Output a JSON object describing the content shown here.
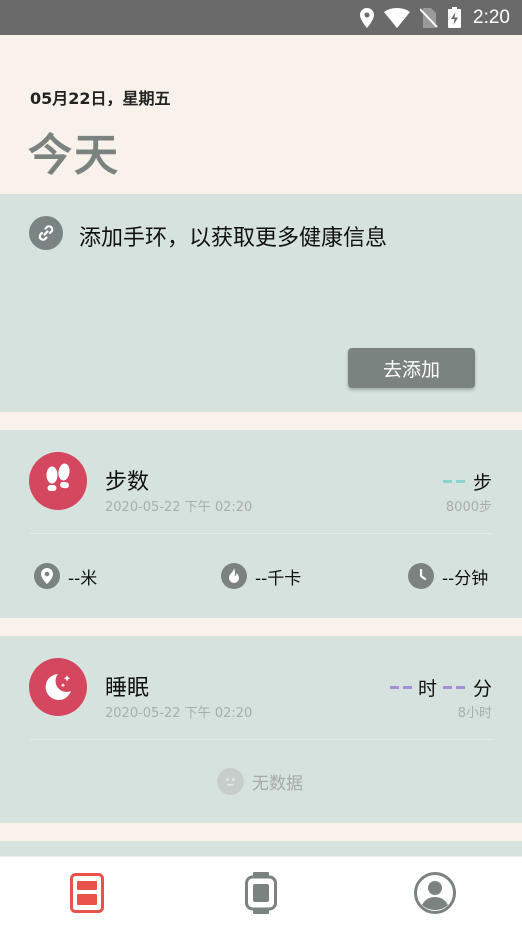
{
  "status_bar": {
    "time": "2:20"
  },
  "header": {
    "date": "05月22日，星期五",
    "title": "今天"
  },
  "bind_card": {
    "message": "添加手环，以获取更多健康信息",
    "add_button": "去添加"
  },
  "steps_card": {
    "title": "步数",
    "time": "2020-05-22 下午 02:20",
    "unit": "步",
    "goal": "8000步",
    "metrics": [
      {
        "value": "--米",
        "icon": "location-icon"
      },
      {
        "value": "--千卡",
        "icon": "flame-icon"
      },
      {
        "value": "--分钟",
        "icon": "clock-icon"
      }
    ]
  },
  "sleep_card": {
    "title": "睡眠",
    "time": "2020-05-22 下午 02:20",
    "hour_unit": "时",
    "minute_unit": "分",
    "goal": "8小时",
    "no_data": "无数据"
  },
  "bottom_nav": [
    {
      "icon": "health-icon",
      "active": true
    },
    {
      "icon": "watch-icon",
      "active": false
    },
    {
      "icon": "profile-icon",
      "active": false
    }
  ],
  "colors": {
    "accent": "#d5475f",
    "card_bg": "#d6e2dd",
    "page_bg": "#f8f2ea",
    "nav_active": "#e8524a",
    "steps_dash": "#8ad3cf",
    "sleep_dash": "#a78fd6"
  }
}
